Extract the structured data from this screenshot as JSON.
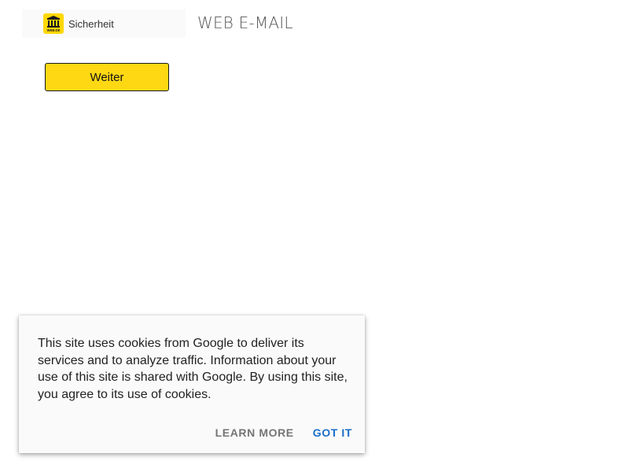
{
  "header": {
    "logo_icon": "webde-gate-logo-icon",
    "logo_text": "WEB.DE",
    "brand_label": "Sicherheit",
    "title": "WEB E-MAIL"
  },
  "main": {
    "continue_label": "Weiter"
  },
  "cookie_banner": {
    "message": "This site uses cookies from Google to deliver its services and to analyze traffic. Information about your use of this site is shared with Google. By using this site, you agree to its use of cookies.",
    "learn_more_label": "LEARN MORE",
    "got_it_label": "GOT IT"
  },
  "colors": {
    "brand_yellow": "#ffd800",
    "button_yellow": "#ffd814",
    "accent_blue": "#1a6fc9",
    "muted_gray": "#757575"
  }
}
